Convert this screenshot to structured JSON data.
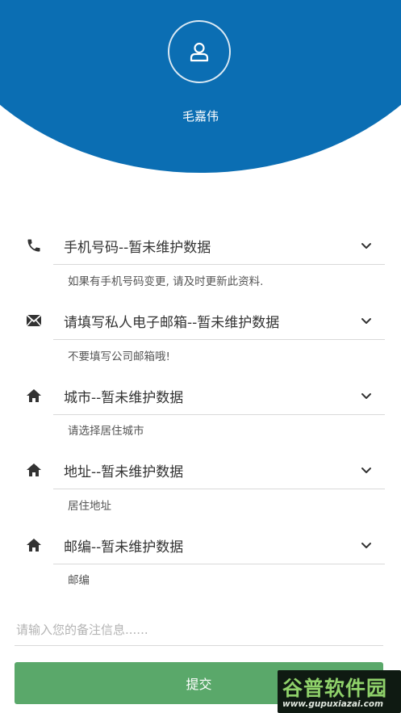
{
  "header": {
    "username": "毛嘉伟",
    "bg_color": "#0b6eb3",
    "avatar_icon": "user-icon"
  },
  "fields": [
    {
      "icon": "phone-icon",
      "label": "手机号码--暂未维护数据",
      "hint": "如果有手机号码变更, 请及时更新此资料."
    },
    {
      "icon": "mail-icon",
      "label": "请填写私人电子邮箱--暂未维护数据",
      "hint": "不要填写公司邮箱哦!"
    },
    {
      "icon": "home-icon",
      "label": "城市--暂未维护数据",
      "hint": "请选择居住城市"
    },
    {
      "icon": "home-icon",
      "label": "地址--暂未维护数据",
      "hint": "居住地址"
    },
    {
      "icon": "home-icon",
      "label": "邮编--暂未维护数据",
      "hint": "邮编"
    }
  ],
  "remarks": {
    "placeholder": "请输入您的备注信息......",
    "value": ""
  },
  "submit": {
    "label": "提交",
    "color": "#5aa86a"
  },
  "watermark": {
    "title": "谷普软件园",
    "url": "www.gupuxiazai.com"
  }
}
